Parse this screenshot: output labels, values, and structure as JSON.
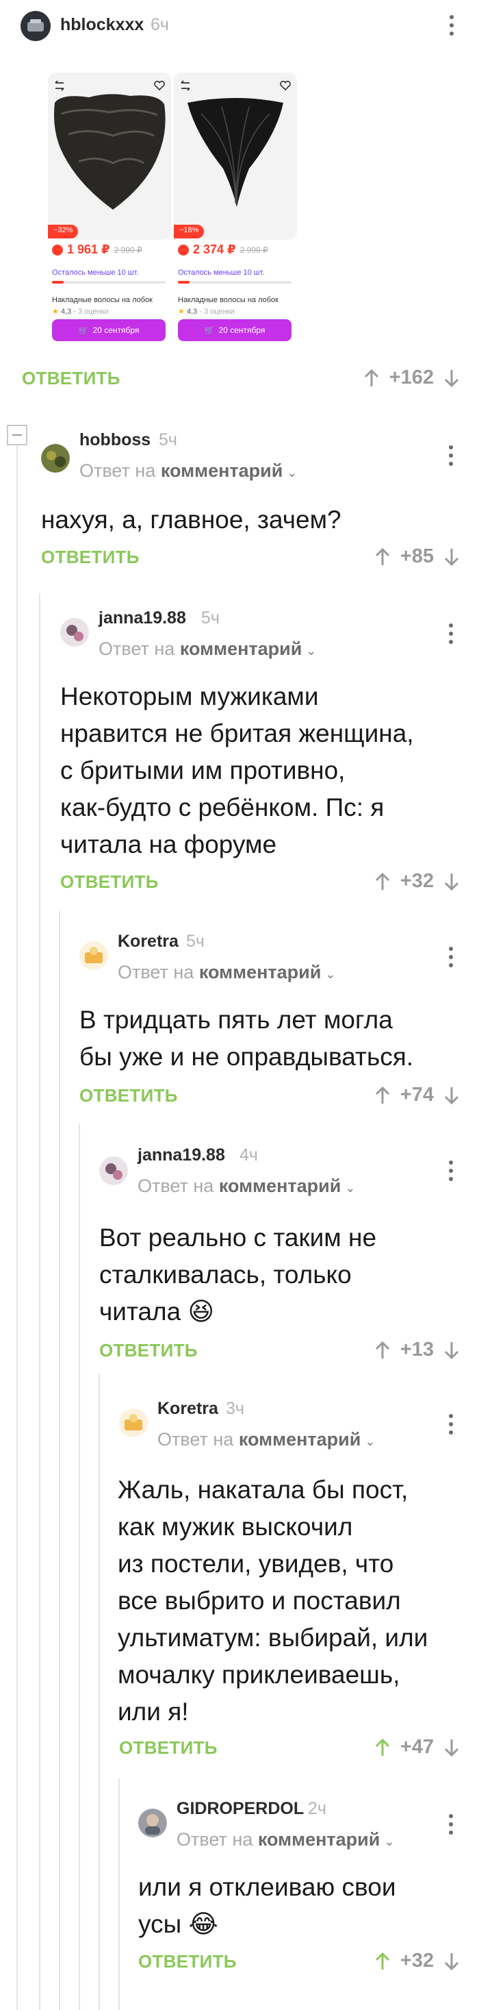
{
  "post": {
    "author": "hblockxxx",
    "time": "6ч",
    "answer_label": "ОТВЕТИТЬ",
    "score": "+162"
  },
  "products": [
    {
      "discount": "−32%",
      "price": "1 961 ₽",
      "old_price": "2 990 ₽",
      "stock": "Осталось меньше 10 шт.",
      "name": "Накладные волосы на лобок",
      "rating": "4,3",
      "reviews": "3 оценки",
      "cta": "20 сентября"
    },
    {
      "discount": "−18%",
      "price": "2 374 ₽",
      "old_price": "2 990 ₽",
      "stock": "Осталось меньше 10 шт.",
      "name": "Накладные волосы на лобок",
      "rating": "4,3",
      "reviews": "3 оценки",
      "cta": "20 сентября"
    }
  ],
  "reply_prefix": "Ответ на",
  "reply_target": "комментарий",
  "comments": [
    {
      "author": "hobboss",
      "time": "5ч",
      "text": "нахуя, а, главное, зачем?",
      "answer_label": "ОТВЕТИТЬ",
      "score": "+85"
    },
    {
      "author": "janna19.88",
      "time": "5ч",
      "lines": [
        "Некоторым мужиками",
        "нравится не бритая женщина,",
        "с бритыми им противно,",
        "как-будто с ребёнком. Пс: я",
        "читала на форуме"
      ],
      "answer_label": "ОТВЕТИТЬ",
      "score": "+32"
    },
    {
      "author": "Koretra",
      "time": "5ч",
      "lines": [
        "В тридцать пять лет могла",
        "бы уже и не оправдываться."
      ],
      "answer_label": "ОТВЕТИТЬ",
      "score": "+74"
    },
    {
      "author": "janna19.88",
      "time": "4ч",
      "lines": [
        "Вот реально с таким не",
        "сталкивалась, только",
        "читала 😆"
      ],
      "answer_label": "ОТВЕТИТЬ",
      "score": "+13"
    },
    {
      "author": "Koretra",
      "time": "3ч",
      "lines": [
        "Жаль, накатала бы пост,",
        "как мужик выскочил",
        "из постели, увидев, что",
        "все выбрито и поставил",
        "ультиматум: выбирай, или",
        "мочалку приклеиваешь,",
        "или я!"
      ],
      "answer_label": "ОТВЕТИТЬ",
      "score": "+47"
    },
    {
      "author": "GIDROPERDOL",
      "time": "2ч",
      "lines": [
        "или я отклеиваю свои",
        "усы 😂"
      ],
      "answer_label": "ОТВЕТИТЬ",
      "score": "+32"
    }
  ],
  "colors": {
    "answer": "#8ac858",
    "upvoted": "#8ac858",
    "price": "#ff3c2a",
    "cta": "#c431e8"
  }
}
